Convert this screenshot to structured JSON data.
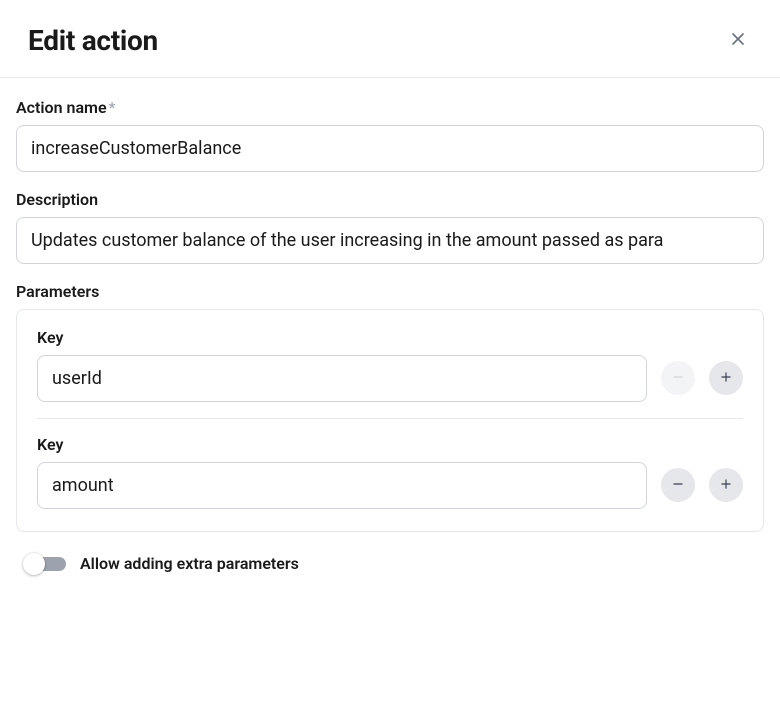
{
  "header": {
    "title": "Edit action"
  },
  "form": {
    "action_name": {
      "label": "Action name",
      "required_marker": "*",
      "value": "increaseCustomerBalance"
    },
    "description": {
      "label": "Description",
      "value": "Updates customer balance of the user increasing in the amount passed as para"
    },
    "parameters": {
      "label": "Parameters",
      "key_label": "Key",
      "items": [
        {
          "value": "userId",
          "remove_disabled": true
        },
        {
          "value": "amount",
          "remove_disabled": false
        }
      ]
    },
    "extra_params": {
      "label": "Allow adding extra parameters",
      "enabled": false
    }
  }
}
